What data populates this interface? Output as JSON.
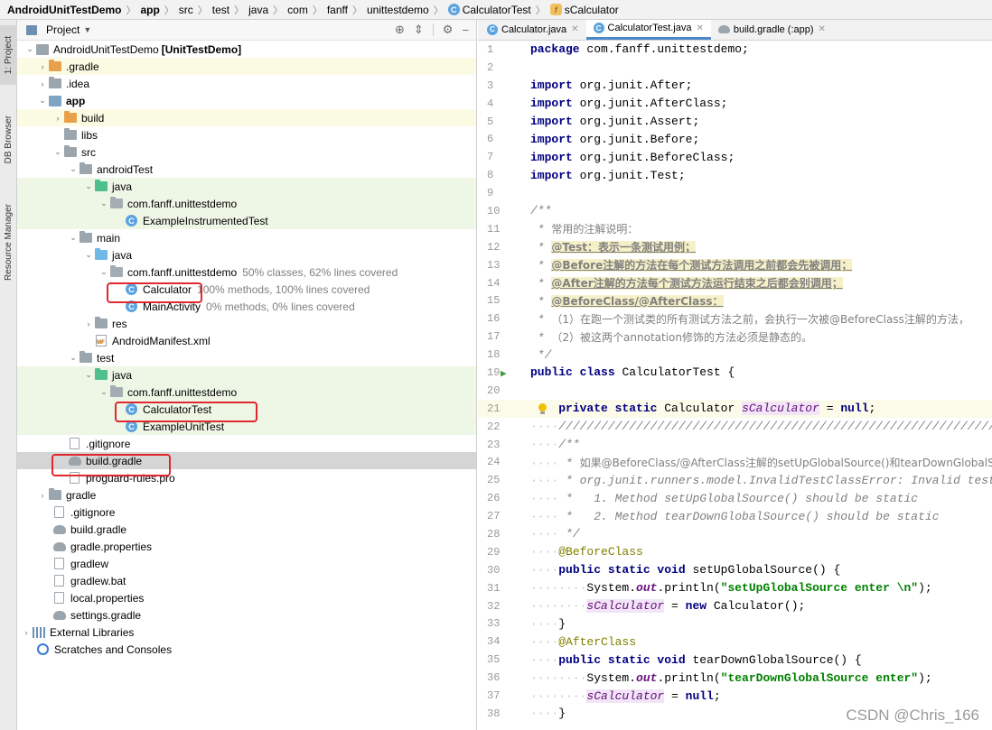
{
  "breadcrumb": {
    "items": [
      "AndroidUnitTestDemo",
      "app",
      "src",
      "test",
      "java",
      "com",
      "fanff",
      "unittestdemo",
      "CalculatorTest",
      "sCalculator"
    ]
  },
  "tool_strip": {
    "project_label": "1: Project",
    "db_label": "DB Browser",
    "resource_label": "Resource Manager"
  },
  "project_panel": {
    "title": "Project",
    "rows": [
      {
        "label": "AndroidUnitTestDemo",
        "extra": "[UnitTestDemo]",
        "coverage": ""
      },
      {
        "label": ".gradle",
        "coverage": ""
      },
      {
        "label": ".idea",
        "coverage": ""
      },
      {
        "label": "app",
        "coverage": ""
      },
      {
        "label": "build",
        "coverage": ""
      },
      {
        "label": "libs",
        "coverage": ""
      },
      {
        "label": "src",
        "coverage": ""
      },
      {
        "label": "androidTest",
        "coverage": ""
      },
      {
        "label": "java",
        "coverage": ""
      },
      {
        "label": "com.fanff.unittestdemo",
        "coverage": ""
      },
      {
        "label": "ExampleInstrumentedTest",
        "coverage": ""
      },
      {
        "label": "main",
        "coverage": ""
      },
      {
        "label": "java",
        "coverage": ""
      },
      {
        "label": "com.fanff.unittestdemo",
        "coverage": "50% classes, 62% lines covered"
      },
      {
        "label": "Calculator",
        "coverage": "100% methods, 100% lines covered"
      },
      {
        "label": "MainActivity",
        "coverage": "0% methods, 0% lines covered"
      },
      {
        "label": "res",
        "coverage": ""
      },
      {
        "label": "AndroidManifest.xml",
        "coverage": ""
      },
      {
        "label": "test",
        "coverage": ""
      },
      {
        "label": "java",
        "coverage": ""
      },
      {
        "label": "com.fanff.unittestdemo",
        "coverage": ""
      },
      {
        "label": "CalculatorTest",
        "coverage": ""
      },
      {
        "label": "ExampleUnitTest",
        "coverage": ""
      },
      {
        "label": ".gitignore",
        "coverage": ""
      },
      {
        "label": "build.gradle",
        "coverage": ""
      },
      {
        "label": "proguard-rules.pro",
        "coverage": ""
      },
      {
        "label": "gradle",
        "coverage": ""
      },
      {
        "label": ".gitignore",
        "coverage": ""
      },
      {
        "label": "build.gradle",
        "coverage": ""
      },
      {
        "label": "gradle.properties",
        "coverage": ""
      },
      {
        "label": "gradlew",
        "coverage": ""
      },
      {
        "label": "gradlew.bat",
        "coverage": ""
      },
      {
        "label": "local.properties",
        "coverage": ""
      },
      {
        "label": "settings.gradle",
        "coverage": ""
      },
      {
        "label": "External Libraries",
        "coverage": ""
      },
      {
        "label": "Scratches and Consoles",
        "coverage": ""
      }
    ]
  },
  "editor": {
    "tabs": [
      {
        "label": "Calculator.java"
      },
      {
        "label": "CalculatorTest.java"
      },
      {
        "label": "build.gradle (:app)"
      }
    ],
    "lines": [
      "1",
      "2",
      "3",
      "4",
      "5",
      "6",
      "7",
      "8",
      "9",
      "10",
      "11",
      "12",
      "13",
      "14",
      "15",
      "16",
      "17",
      "18",
      "19",
      "20",
      "21",
      "22",
      "23",
      "24",
      "25",
      "26",
      "27",
      "28",
      "29",
      "30",
      "31",
      "32",
      "33",
      "34",
      "35",
      "36",
      "37",
      "38"
    ],
    "code": {
      "l1": "com.fanff.unittestdemo;",
      "imports": [
        "org.junit.After;",
        "org.junit.AfterClass;",
        "org.junit.Assert;",
        "org.junit.Before;",
        "org.junit.BeforeClass;",
        "org.junit.Test;"
      ],
      "l11": "常用的注解说明：",
      "l12": "@Test：表示一条测试用例；",
      "l13": "@Before注解的方法在每个测试方法调用之前都会先被调用；",
      "l14": "@After注解的方法每个测试方法运行结束之后都会别调用；",
      "l15": "@BeforeClass/@AfterClass：",
      "l16": "（1）在跑一个测试类的所有测试方法之前，会执行一次被@BeforeClass注解的方法，",
      "l17": "（2）被这两个annotation修饰的方法必须是静态的。",
      "l19_name": "CalculatorTest {",
      "l21_type": "Calculator",
      "l21_field": "sCalculator",
      "l22": "////////////////////////////////////////////////////////////////////////",
      "l24": "如果@BeforeClass/@AfterClass注解的setUpGlobalSource()和tearDownGlobalSource()",
      "l25": "org.junit.runners.model.InvalidTestClassError: Invalid test class",
      "l26": "1. Method setUpGlobalSource() should be static",
      "l27": "2. Method tearDownGlobalSource() should be static",
      "l29": "@BeforeClass",
      "l30": "setUpGlobalSource() {",
      "l31_str": "\"setUpGlobalSource enter \\n\"",
      "l32_rest": "Calculator();",
      "l34": "@AfterClass",
      "l35": "tearDownGlobalSource() {",
      "l36_str": "\"tearDownGlobalSource enter\""
    }
  },
  "watermark": "CSDN @Chris_166"
}
